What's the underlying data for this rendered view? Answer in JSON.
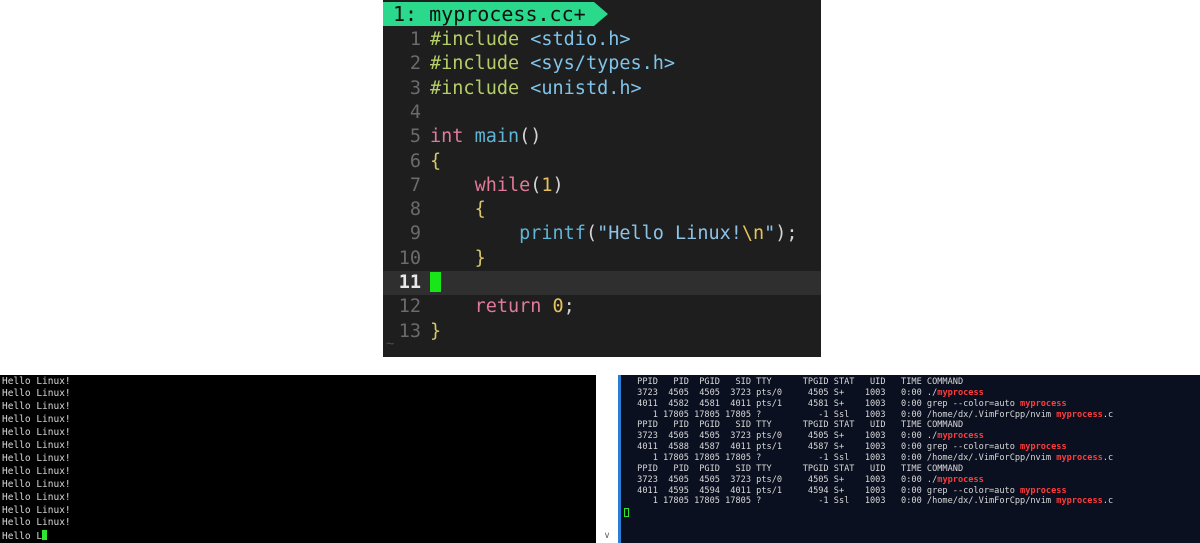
{
  "editor": {
    "tab_label": "1: myprocess.cc+",
    "tilde": "~",
    "lines": [
      {
        "n": "1",
        "current": false,
        "tokens": [
          [
            "pp",
            "#include "
          ],
          [
            "inc",
            "<stdio.h>"
          ]
        ]
      },
      {
        "n": "2",
        "current": false,
        "tokens": [
          [
            "pp",
            "#include "
          ],
          [
            "inc",
            "<sys/types.h>"
          ]
        ]
      },
      {
        "n": "3",
        "current": false,
        "tokens": [
          [
            "pp",
            "#include "
          ],
          [
            "inc",
            "<unistd.h>"
          ]
        ]
      },
      {
        "n": "4",
        "current": false,
        "tokens": []
      },
      {
        "n": "5",
        "current": false,
        "tokens": [
          [
            "kw",
            "int "
          ],
          [
            "fn",
            "main"
          ],
          [
            "",
            "()"
          ]
        ]
      },
      {
        "n": "6",
        "current": false,
        "tokens": [
          [
            "br",
            "{"
          ]
        ]
      },
      {
        "n": "7",
        "current": false,
        "tokens": [
          [
            "",
            "    "
          ],
          [
            "kw",
            "while"
          ],
          [
            "",
            "("
          ],
          [
            "num",
            "1"
          ],
          [
            "",
            ")"
          ]
        ]
      },
      {
        "n": "8",
        "current": false,
        "tokens": [
          [
            "",
            "    "
          ],
          [
            "br",
            "{"
          ]
        ]
      },
      {
        "n": "9",
        "current": false,
        "tokens": [
          [
            "",
            "        "
          ],
          [
            "fn",
            "printf"
          ],
          [
            "",
            "("
          ],
          [
            "str",
            "\"Hello Linux!"
          ],
          [
            "esc",
            "\\n"
          ],
          [
            "str",
            "\""
          ],
          [
            "",
            ");"
          ]
        ]
      },
      {
        "n": "10",
        "current": false,
        "tokens": [
          [
            "",
            "    "
          ],
          [
            "br",
            "}"
          ]
        ]
      },
      {
        "n": "11",
        "current": true,
        "tokens": [
          [
            "cursor",
            ""
          ]
        ]
      },
      {
        "n": "12",
        "current": false,
        "tokens": [
          [
            "",
            "    "
          ],
          [
            "kw",
            "return "
          ],
          [
            "num",
            "0"
          ],
          [
            "",
            ";"
          ]
        ]
      },
      {
        "n": "13",
        "current": false,
        "tokens": [
          [
            "br",
            "}"
          ]
        ]
      }
    ]
  },
  "left_terminal": {
    "lines": [
      "Hello Linux!",
      "Hello Linux!",
      "Hello Linux!",
      "Hello Linux!",
      "Hello Linux!",
      "Hello Linux!",
      "Hello Linux!",
      "Hello Linux!",
      "Hello Linux!",
      "Hello Linux!",
      "Hello Linux!",
      "Hello Linux!"
    ],
    "last_line": "Hello L"
  },
  "right_terminal": {
    "lines": [
      [
        [
          "",
          " PPID   PID  PGID   SID TTY      TPGID STAT   UID   TIME COMMAND"
        ]
      ],
      [
        [
          "",
          " 3723  4505  4505  3723 pts/0     4505 S+    1003   0:00 ./"
        ],
        [
          "hl",
          "myprocess"
        ]
      ],
      [
        [
          "",
          " 4011  4582  4581  4011 pts/1     4581 S+    1003   0:00 grep --color=auto "
        ],
        [
          "hl",
          "myprocess"
        ]
      ],
      [
        [
          "",
          "    1 17805 17805 17805 ?           -1 Ssl   1003   0:00 /home/dx/.VimForCpp/nvim "
        ],
        [
          "hl",
          "myprocess"
        ],
        [
          "",
          ".c"
        ]
      ],
      [
        [
          "",
          " PPID   PID  PGID   SID TTY      TPGID STAT   UID   TIME COMMAND"
        ]
      ],
      [
        [
          "",
          " 3723  4505  4505  3723 pts/0     4505 S+    1003   0:00 ./"
        ],
        [
          "hl",
          "myprocess"
        ]
      ],
      [
        [
          "",
          " 4011  4588  4587  4011 pts/1     4587 S+    1003   0:00 grep --color=auto "
        ],
        [
          "hl",
          "myprocess"
        ]
      ],
      [
        [
          "",
          "    1 17805 17805 17805 ?           -1 Ssl   1003   0:00 /home/dx/.VimForCpp/nvim "
        ],
        [
          "hl",
          "myprocess"
        ],
        [
          "",
          ".c"
        ]
      ],
      [
        [
          "",
          " PPID   PID  PGID   SID TTY      TPGID STAT   UID   TIME COMMAND"
        ]
      ],
      [
        [
          "",
          " 3723  4505  4505  3723 pts/0     4505 S+    1003   0:00 ./"
        ],
        [
          "hl",
          "myprocess"
        ]
      ],
      [
        [
          "",
          " 4011  4595  4594  4011 pts/1     4594 S+    1003   0:00 grep --color=auto "
        ],
        [
          "hl",
          "myprocess"
        ]
      ],
      [
        [
          "",
          "    1 17805 17805 17805 ?           -1 Ssl   1003   0:00 /home/dx/.VimForCpp/nvim "
        ],
        [
          "hl",
          "myprocess"
        ],
        [
          "",
          ".c"
        ]
      ]
    ]
  },
  "scrollbar": {
    "down_arrow": "∨"
  },
  "colors": {
    "tab_green": "#2bd98c",
    "cursor_green": "#19e619",
    "highlight_red": "#ff3b3b",
    "pane_border_blue": "#2a7fd4"
  }
}
